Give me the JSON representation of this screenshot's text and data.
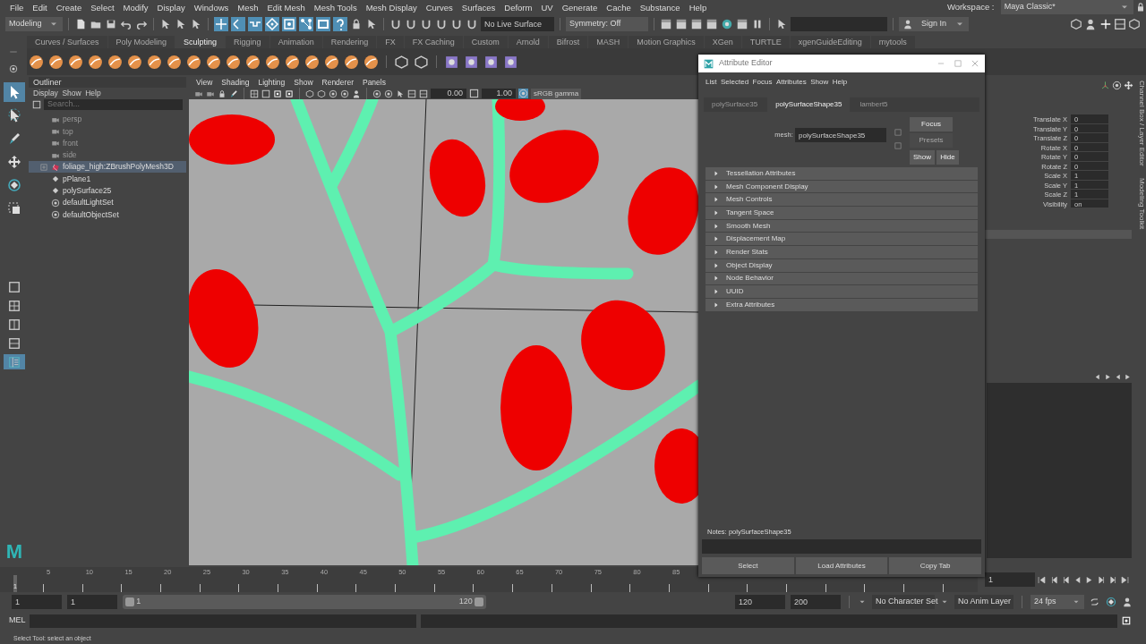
{
  "menu_bar": [
    "File",
    "Edit",
    "Create",
    "Select",
    "Modify",
    "Display",
    "Windows",
    "Mesh",
    "Edit Mesh",
    "Mesh Tools",
    "Mesh Display",
    "Curves",
    "Surfaces",
    "Deform",
    "UV",
    "Generate",
    "Cache",
    "Substance",
    "Help"
  ],
  "status_line": {
    "mode": "Modeling",
    "toggles": [
      {
        "kind": "grid",
        "on": true
      },
      {
        "kind": "curve",
        "on": true
      },
      {
        "kind": "wave",
        "on": true
      },
      {
        "kind": "point",
        "on": true
      },
      {
        "kind": "box",
        "on": true
      },
      {
        "kind": "nodes",
        "on": true
      },
      {
        "kind": "film",
        "on": true
      },
      {
        "kind": "help",
        "on": true
      }
    ],
    "live_surface": "No Live Surface",
    "symmetry": "Symmetry: Off",
    "sign_in": "Sign In",
    "workspace_label": "Workspace :",
    "workspace": "Maya Classic*"
  },
  "shelf_tabs": [
    {
      "label": "Curves / Surfaces",
      "selected": false
    },
    {
      "label": "Poly Modeling",
      "selected": false
    },
    {
      "label": "Sculpting",
      "selected": true
    },
    {
      "label": "Rigging",
      "selected": false
    },
    {
      "label": "Animation",
      "selected": false
    },
    {
      "label": "Rendering",
      "selected": false
    },
    {
      "label": "FX",
      "selected": false
    },
    {
      "label": "FX Caching",
      "selected": false
    },
    {
      "label": "Custom",
      "selected": false
    },
    {
      "label": "Arnold",
      "selected": false
    },
    {
      "label": "Bifrost",
      "selected": false
    },
    {
      "label": "MASH",
      "selected": false
    },
    {
      "label": "Motion Graphics",
      "selected": false
    },
    {
      "label": "XGen",
      "selected": false
    },
    {
      "label": "TURTLE",
      "selected": false
    },
    {
      "label": "xgenGuideEditing",
      "selected": false
    },
    {
      "label": "mytools",
      "selected": false
    }
  ],
  "toolbox": {
    "tools": [
      {
        "kind": "select",
        "selected": true
      },
      {
        "kind": "lasso",
        "selected": false
      },
      {
        "kind": "paint",
        "selected": false
      },
      {
        "kind": "move",
        "selected": false
      },
      {
        "kind": "rotate",
        "selected": false
      },
      {
        "kind": "scale",
        "selected": false
      }
    ],
    "layouts": [
      {
        "kind": "single",
        "selected": false
      },
      {
        "kind": "quad",
        "selected": false
      },
      {
        "kind": "split",
        "selected": false
      },
      {
        "kind": "stack",
        "selected": false
      },
      {
        "kind": "outliner",
        "selected": true
      }
    ],
    "logo": "M"
  },
  "outliner": {
    "title": "Outliner",
    "menu": [
      "Display",
      "Show",
      "Help"
    ],
    "search_placeholder": "Search...",
    "items": [
      {
        "label": "persp",
        "kind": "camera",
        "dimmed": true,
        "expandable": false,
        "selected": false
      },
      {
        "label": "top",
        "kind": "camera",
        "dimmed": true,
        "expandable": false,
        "selected": false
      },
      {
        "label": "front",
        "kind": "camera",
        "dimmed": true,
        "expandable": false,
        "selected": false
      },
      {
        "label": "side",
        "kind": "camera",
        "dimmed": true,
        "expandable": false,
        "selected": false
      },
      {
        "label": "foliage_high:ZBrushPolyMesh3D",
        "kind": "mesh",
        "dimmed": false,
        "expandable": true,
        "selected": true
      },
      {
        "label": "pPlane1",
        "kind": "transform",
        "dimmed": false,
        "expandable": false,
        "selected": false
      },
      {
        "label": "polySurface25",
        "kind": "transform",
        "dimmed": false,
        "expandable": false,
        "selected": false
      },
      {
        "label": "defaultLightSet",
        "kind": "set",
        "dimmed": false,
        "expandable": false,
        "selected": false
      },
      {
        "label": "defaultObjectSet",
        "kind": "set",
        "dimmed": false,
        "expandable": false,
        "selected": false
      }
    ]
  },
  "viewport": {
    "menu": [
      "View",
      "Shading",
      "Lighting",
      "Show",
      "Renderer",
      "Panels"
    ],
    "exposure": "0.00",
    "gamma": "1.00",
    "color_space": "sRGB gamma"
  },
  "channel_box": {
    "side_tabs": [
      "Channel Box / Layer Editor",
      "Modeling Toolkit"
    ],
    "channels": [
      {
        "name": "Translate X",
        "value": "0"
      },
      {
        "name": "Translate Y",
        "value": "0"
      },
      {
        "name": "Translate Z",
        "value": "0"
      },
      {
        "name": "Rotate X",
        "value": "0"
      },
      {
        "name": "Rotate Y",
        "value": "0"
      },
      {
        "name": "Rotate Z",
        "value": "0"
      },
      {
        "name": "Scale X",
        "value": "1"
      },
      {
        "name": "Scale Y",
        "value": "1"
      },
      {
        "name": "Scale Z",
        "value": "1"
      },
      {
        "name": "Visibility",
        "value": "on"
      }
    ]
  },
  "attribute_editor": {
    "title": "Attribute Editor",
    "menu": [
      "List",
      "Selected",
      "Focus",
      "Attributes",
      "Show",
      "Help"
    ],
    "tabs": [
      {
        "label": "polySurface35",
        "selected": false
      },
      {
        "label": "polySurfaceShape35",
        "selected": true
      },
      {
        "label": "lambert5",
        "selected": false
      }
    ],
    "mesh_label": "mesh:",
    "mesh_value": "polySurfaceShape35",
    "buttons": [
      {
        "label": "Focus",
        "disabled": false
      },
      {
        "label": "Presets",
        "disabled": true
      },
      {
        "label": "Show",
        "disabled": false
      },
      {
        "label": "Hide",
        "disabled": false
      }
    ],
    "sections": [
      {
        "label": "Tessellation Attributes",
        "expanded": false
      },
      {
        "label": "Mesh Component Display",
        "expanded": false
      },
      {
        "label": "Mesh Controls",
        "expanded": false
      },
      {
        "label": "Tangent Space",
        "expanded": false
      },
      {
        "label": "Smooth Mesh",
        "expanded": false
      },
      {
        "label": "Displacement Map",
        "expanded": false
      },
      {
        "label": "Render Stats",
        "expanded": false
      },
      {
        "label": "Object Display",
        "expanded": false
      },
      {
        "label": "Node Behavior",
        "expanded": false
      },
      {
        "label": "UUID",
        "expanded": false
      },
      {
        "label": "Extra Attributes",
        "expanded": false
      }
    ],
    "notes_label": "Notes:",
    "notes_value": "polySurfaceShape35",
    "footer_buttons": [
      "Select",
      "Load Attributes",
      "Copy Tab"
    ]
  },
  "time_slider": {
    "current_marker": "1",
    "ticks": [
      "5",
      "10",
      "15",
      "20",
      "25",
      "30",
      "35",
      "40",
      "45",
      "50",
      "55",
      "60",
      "65",
      "70",
      "75",
      "80",
      "85"
    ],
    "current_frame": "1"
  },
  "range_slider": {
    "level": 1,
    "anim_start": "1",
    "playback_start": "1",
    "range_start": "1",
    "range_end": "120",
    "playback_end": "120",
    "anim_end": "200",
    "character_set": "No Character Set",
    "anim_layer": "No Anim Layer",
    "fps": "24 fps"
  },
  "command_line": {
    "language": "MEL"
  },
  "help_line": "Select Tool: select an object"
}
